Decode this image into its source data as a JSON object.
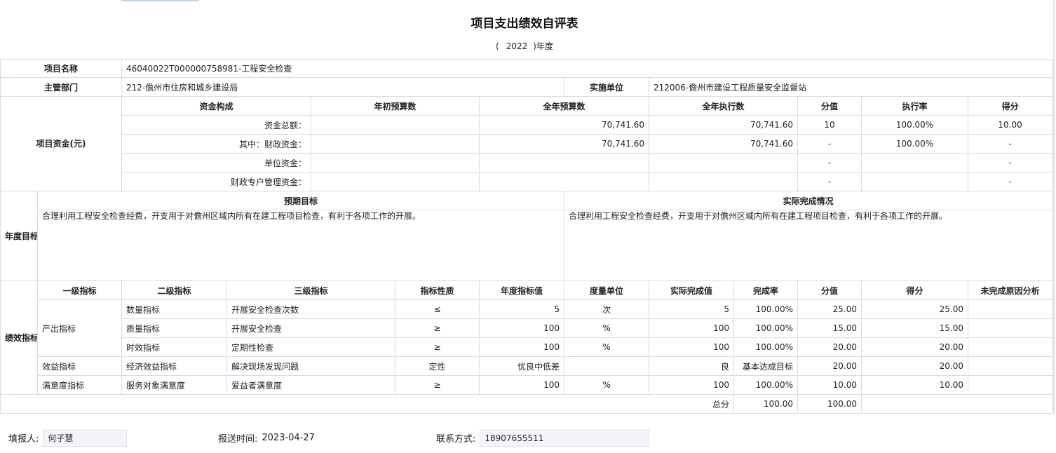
{
  "title": "项目支出绩效自评表",
  "year": {
    "open": "(",
    "value": "2022",
    "close": ")年度"
  },
  "project": {
    "name_label": "项目名称",
    "name_value": "46040022T000000758981-工程安全检查",
    "dept_label": "主管部门",
    "dept_value": "212-儋州市住房和城乡建设局",
    "unit_label": "实施单位",
    "unit_value": "212006-儋州市建设工程质量安全监督站"
  },
  "funds": {
    "section_label": "项目资金(元)",
    "headers": [
      "资金构成",
      "年初预算数",
      "全年预算数",
      "全年执行数",
      "分值",
      "执行率",
      "得分"
    ],
    "rows": [
      {
        "label": "资金总额：",
        "initial": "",
        "annual": "70,741.60",
        "executed": "70,741.60",
        "score_value": "10",
        "rate": "100.00%",
        "score": "10.00"
      },
      {
        "label": "其中：财政资金：",
        "initial": "",
        "annual": "70,741.60",
        "executed": "70,741.60",
        "score_value": "-",
        "rate": "100.00%",
        "score": "-"
      },
      {
        "label": "单位资金：",
        "initial": "",
        "annual": "",
        "executed": "",
        "score_value": "-",
        "rate": "",
        "score": "-"
      },
      {
        "label": "财政专户管理资金：",
        "initial": "",
        "annual": "",
        "executed": "",
        "score_value": "-",
        "rate": "",
        "score": "-"
      }
    ]
  },
  "annual_goal": {
    "section_label": "年度目标",
    "expected_header": "预期目标",
    "actual_header": "实际完成情况",
    "expected_text": "合理利用工程安全检查经费，开支用于对儋州区域内所有在建工程项目检查，有利于各项工作的开展。",
    "actual_text": "合理利用工程安全检查经费，开支用于对儋州区域内所有在建工程项目检查，有利于各项工作的开展。"
  },
  "performance": {
    "section_label": "绩效指标",
    "headers": [
      "一级指标",
      "二级指标",
      "三级指标",
      "指标性质",
      "年度指标值",
      "度量单位",
      "实际完成值",
      "完成率",
      "分值",
      "得分",
      "未完成原因分析"
    ],
    "rows": [
      {
        "l1": "产出指标",
        "l2": "数量指标",
        "l3": "开展安全检查次数",
        "nature": "≤",
        "target": "5",
        "unit": "次",
        "actual": "5",
        "rate": "100.00%",
        "score_value": "25.00",
        "score": "25.00",
        "reason": ""
      },
      {
        "l1": "",
        "l2": "质量指标",
        "l3": "开展安全检查",
        "nature": "≥",
        "target": "100",
        "unit": "%",
        "actual": "100",
        "rate": "100.00%",
        "score_value": "15.00",
        "score": "15.00",
        "reason": ""
      },
      {
        "l1": "",
        "l2": "时效指标",
        "l3": "定期性检查",
        "nature": "≥",
        "target": "100",
        "unit": "%",
        "actual": "100",
        "rate": "100.00%",
        "score_value": "20.00",
        "score": "20.00",
        "reason": ""
      },
      {
        "l1": "效益指标",
        "l2": "经济效益指标",
        "l3": "解决现场发现问题",
        "nature": "定性",
        "target": "优良中低差",
        "unit": "",
        "actual": "良",
        "rate": "基本达成目标",
        "score_value": "20.00",
        "score": "20.00",
        "reason": ""
      },
      {
        "l1": "满意度指标",
        "l2": "服务对象满意度",
        "l3": "爱益者满意度",
        "nature": "≥",
        "target": "100",
        "unit": "%",
        "actual": "100",
        "rate": "100.00%",
        "score_value": "10.00",
        "score": "10.00",
        "reason": ""
      }
    ],
    "total_label": "总分",
    "total_score_value": "100.00",
    "total_score": "100.00"
  },
  "footer": {
    "filler_label": "填报人:",
    "filler_value": "何子慧",
    "time_label": "报送时间:",
    "time_value": "2023-04-27",
    "contact_label": "联系方式:",
    "contact_value": "18907655511"
  }
}
